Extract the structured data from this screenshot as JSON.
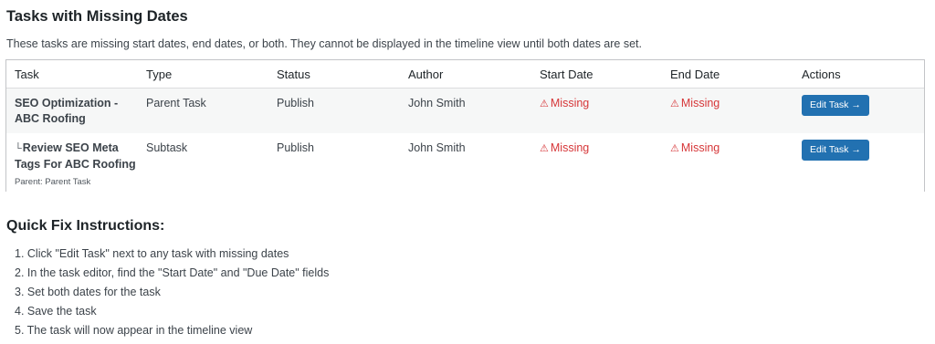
{
  "page": {
    "title": "Tasks with Missing Dates",
    "intro": "These tasks are missing start dates, end dates, or both. They cannot be displayed in the timeline view until both dates are set."
  },
  "table": {
    "headers": [
      "Task",
      "Type",
      "Status",
      "Author",
      "Start Date",
      "End Date",
      "Actions"
    ],
    "rows": [
      {
        "task_line1": "SEO Optimization -",
        "task_line2": "ABC Roofing",
        "type": "Parent Task",
        "status": "Publish",
        "author": "John Smith",
        "start_date": "Missing",
        "end_date": "Missing",
        "action": "Edit Task →"
      },
      {
        "sub_marker": "└",
        "task_line1": "Review SEO Meta",
        "task_line2": "Tags For ABC Roofing",
        "parent_note": "Parent: Parent Task",
        "type": "Subtask",
        "status": "Publish",
        "author": "John Smith",
        "start_date": "Missing",
        "end_date": "Missing",
        "action": "Edit Task →"
      }
    ],
    "warning_glyph": "⚠",
    "missing_color": "#d63638",
    "button_color": "#2271b1"
  },
  "quick_fix": {
    "title": "Quick Fix Instructions:",
    "steps": [
      "1. Click \"Edit Task\" next to any task with missing dates",
      "2. In the task editor, find the \"Start Date\" and \"Due Date\" fields",
      "3. Set both dates for the task",
      "4. Save the task",
      "5. The task will now appear in the timeline view"
    ]
  }
}
